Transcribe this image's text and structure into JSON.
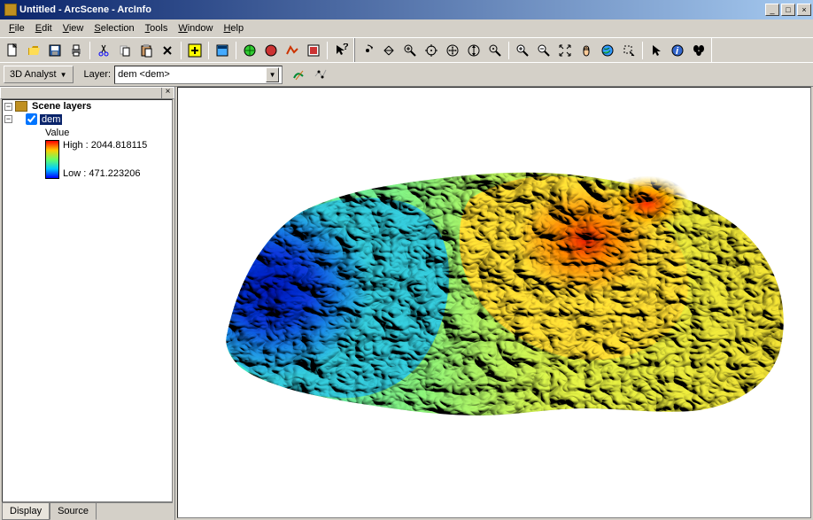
{
  "window": {
    "title": "Untitled - ArcScene - ArcInfo"
  },
  "menu": {
    "file": "File",
    "edit": "Edit",
    "view": "View",
    "selection": "Selection",
    "tools": "Tools",
    "window": "Window",
    "help": "Help"
  },
  "toolbar1": {
    "icons": [
      "new-file",
      "open",
      "save",
      "print",
      "cut",
      "copy",
      "paste",
      "delete",
      "add-data",
      "scene-props",
      "nav",
      "globe-zoom",
      "render",
      "box",
      "help-pointer",
      "rotate",
      "zoom-in",
      "zoom-out",
      "center",
      "pan-xy",
      "pan-z",
      "zoom-target",
      "zoom-box-in",
      "zoom-box-out",
      "full-extent",
      "pan",
      "globe",
      "select-feature",
      "pointer",
      "identify",
      "find"
    ]
  },
  "toolbar2": {
    "analyst_label": "3D Analyst",
    "layer_label": "Layer:",
    "layer_value": "dem <dem>",
    "icons": [
      "interpolate-line",
      "interpolate-point"
    ]
  },
  "toc": {
    "root": "Scene layers",
    "layer": "dem",
    "value_label": "Value",
    "high_label": "High : 2044.818115",
    "low_label": "Low : 471.223206",
    "tabs": {
      "display": "Display",
      "source": "Source"
    }
  }
}
